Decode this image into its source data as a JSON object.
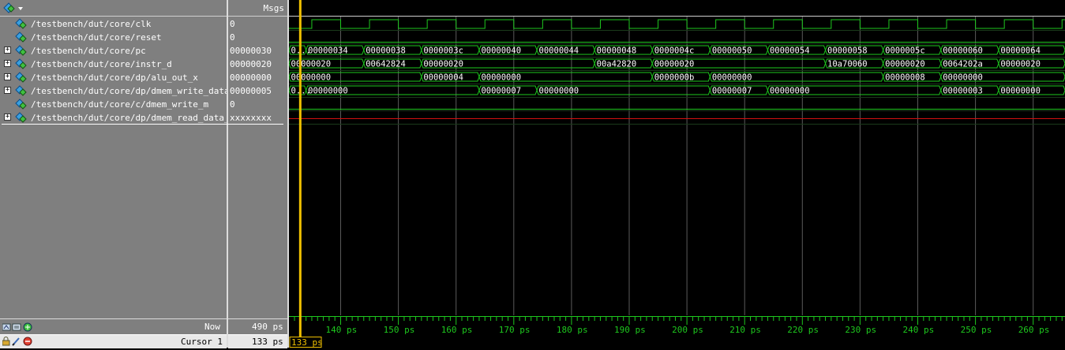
{
  "header": {
    "msgs": "Msgs"
  },
  "signals": [
    {
      "name": "/testbench/dut/core/clk",
      "value": "0",
      "expandable": false
    },
    {
      "name": "/testbench/dut/core/reset",
      "value": "0",
      "expandable": false
    },
    {
      "name": "/testbench/dut/core/pc",
      "value": "00000030",
      "expandable": true
    },
    {
      "name": "/testbench/dut/core/instr_d",
      "value": "00000020",
      "expandable": true
    },
    {
      "name": "/testbench/dut/core/dp/alu_out_x",
      "value": "00000000",
      "expandable": true
    },
    {
      "name": "/testbench/dut/core/dp/dmem_write_data_m",
      "value": "00000005",
      "expandable": true
    },
    {
      "name": "/testbench/dut/core/c/dmem_write_m",
      "value": "0",
      "expandable": false
    },
    {
      "name": "/testbench/dut/core/dp/dmem_read_data_m",
      "value": "xxxxxxxx",
      "expandable": true
    }
  ],
  "status": {
    "now_label": "Now",
    "now_value": "490 ps",
    "cursor_label": "Cursor 1",
    "cursor_value": "133 ps",
    "cursor_flag": "133 ps"
  },
  "timeline": {
    "unit": "ps",
    "labels": [
      "140 ps",
      "150 ps",
      "160 ps",
      "170 ps",
      "180 ps",
      "190 ps",
      "200 ps",
      "210 ps",
      "220 ps",
      "230 ps",
      "240 ps",
      "250 ps",
      "260 ps"
    ],
    "label_times": [
      140,
      150,
      160,
      170,
      180,
      190,
      200,
      210,
      220,
      230,
      240,
      250,
      260
    ],
    "cursor_time": 133
  },
  "waves": {
    "pc": [
      {
        "t": 130,
        "v": "0..."
      },
      {
        "t": 134,
        "v": "00000034"
      },
      {
        "t": 144,
        "v": "00000038"
      },
      {
        "t": 154,
        "v": "0000003c"
      },
      {
        "t": 164,
        "v": "00000040"
      },
      {
        "t": 174,
        "v": "00000044"
      },
      {
        "t": 184,
        "v": "00000048"
      },
      {
        "t": 194,
        "v": "0000004c"
      },
      {
        "t": 204,
        "v": "00000050"
      },
      {
        "t": 214,
        "v": "00000054"
      },
      {
        "t": 224,
        "v": "00000058"
      },
      {
        "t": 234,
        "v": "0000005c"
      },
      {
        "t": 244,
        "v": "00000060"
      },
      {
        "t": 254,
        "v": "00000064"
      }
    ],
    "instr_d": [
      {
        "t": 130,
        "v": "00000020"
      },
      {
        "t": 144,
        "v": "00642824"
      },
      {
        "t": 154,
        "v": "00000020"
      },
      {
        "t": 184,
        "v": "00a42820"
      },
      {
        "t": 194,
        "v": "00000020"
      },
      {
        "t": 224,
        "v": "10a70060"
      },
      {
        "t": 234,
        "v": "00000020"
      },
      {
        "t": 244,
        "v": "0064202a"
      },
      {
        "t": 254,
        "v": "00000020"
      }
    ],
    "alu_out_x": [
      {
        "t": 130,
        "v": "00000000"
      },
      {
        "t": 154,
        "v": "00000004"
      },
      {
        "t": 164,
        "v": "00000000"
      },
      {
        "t": 194,
        "v": "0000000b"
      },
      {
        "t": 204,
        "v": "00000000"
      },
      {
        "t": 234,
        "v": "00000008"
      },
      {
        "t": 244,
        "v": "00000000"
      }
    ],
    "dmem_write_data_m": [
      {
        "t": 130,
        "v": "0..."
      },
      {
        "t": 134,
        "v": "00000000"
      },
      {
        "t": 164,
        "v": "00000007"
      },
      {
        "t": 174,
        "v": "00000000"
      },
      {
        "t": 204,
        "v": "00000007"
      },
      {
        "t": 214,
        "v": "00000000"
      },
      {
        "t": 244,
        "v": "00000003"
      },
      {
        "t": 254,
        "v": "00000000"
      }
    ]
  },
  "colors": {
    "wave": "#1ec81e",
    "cursor": "#f0c000",
    "x_value": "#d01010",
    "grid": "#5a5a5a",
    "bus_text": "#ffffff"
  },
  "icons": {
    "header": "layout-diamond-icon",
    "signal": "signal-diamond-icon",
    "footer_left_1": [
      "wave-add-icon",
      "list-icon",
      "zoom-in-icon"
    ],
    "footer_left_2": [
      "lock-icon",
      "edit-icon",
      "remove-icon"
    ]
  }
}
